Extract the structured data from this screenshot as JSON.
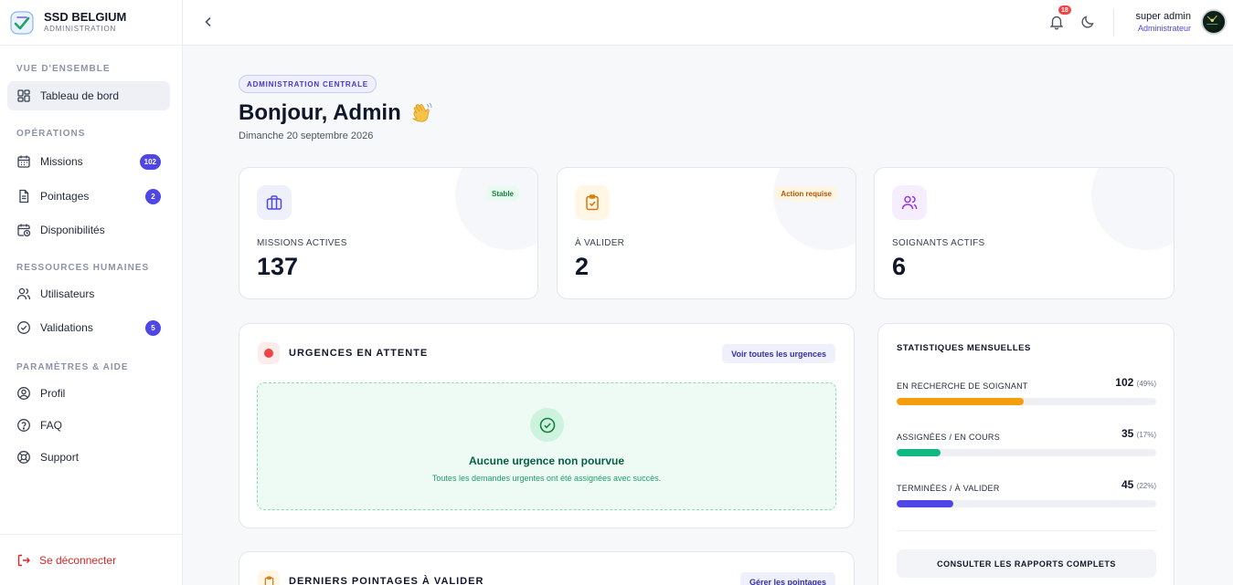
{
  "brand": {
    "name": "SSD BELGIUM",
    "subtitle": "ADMINISTRATION"
  },
  "sidebar": {
    "sections": {
      "overview": "VUE D'ENSEMBLE",
      "operations": "OPÉRATIONS",
      "hr": "RESSOURCES HUMAINES",
      "settings": "PARAMÈTRES & AIDE"
    },
    "items": [
      {
        "label": "Tableau de bord",
        "icon": "dashboard-icon",
        "active": true
      },
      {
        "label": "Missions",
        "icon": "calendar-icon",
        "badge": "102"
      },
      {
        "label": "Pointages",
        "icon": "document-icon",
        "badge": "2"
      },
      {
        "label": "Disponibilités",
        "icon": "calendar-clock-icon"
      },
      {
        "label": "Utilisateurs",
        "icon": "users-icon"
      },
      {
        "label": "Validations",
        "icon": "check-circle-icon",
        "badge": "5"
      },
      {
        "label": "Profil",
        "icon": "user-circle-icon"
      },
      {
        "label": "FAQ",
        "icon": "help-circle-icon"
      },
      {
        "label": "Support",
        "icon": "lifebuoy-icon"
      }
    ],
    "logout": "Se déconnecter"
  },
  "topbar": {
    "notification_count": "18",
    "user_name": "super admin",
    "user_role": "Administrateur"
  },
  "header": {
    "pill": "ADMINISTRATION CENTRALE",
    "greeting": "Bonjour, Admin",
    "date": "Dimanche 20 septembre 2026"
  },
  "kpis": [
    {
      "label": "MISSIONS ACTIVES",
      "value": "137",
      "tag": "Stable",
      "icon": "briefcase-icon",
      "color": "#4f46e5"
    },
    {
      "label": "À VALIDER",
      "value": "2",
      "tag": "Action requise",
      "icon": "clipboard-check-icon",
      "color": "#d97706"
    },
    {
      "label": "SOIGNANTS ACTIFS",
      "value": "6",
      "tag": "",
      "icon": "users-icon",
      "color": "#9333ea"
    }
  ],
  "urgences": {
    "title": "URGENCES EN ATTENTE",
    "button": "Voir toutes les urgences",
    "empty_title": "Aucune urgence non pourvue",
    "empty_text": "Toutes les demandes urgentes ont été assignées avec succès."
  },
  "pointages": {
    "title": "DERNIERS POINTAGES À VALIDER",
    "button": "Gérer les pointages"
  },
  "stats": {
    "title": "STATISTIQUES MENSUELLES",
    "rows": [
      {
        "label": "EN RECHERCHE DE SOIGNANT",
        "value": "102",
        "percent": "(49%)",
        "fraction": 0.49,
        "color": "#f59e0b"
      },
      {
        "label": "ASSIGNÉES / EN COURS",
        "value": "35",
        "percent": "(17%)",
        "fraction": 0.17,
        "color": "#10b981"
      },
      {
        "label": "TERMINÉES / À VALIDER",
        "value": "45",
        "percent": "(22%)",
        "fraction": 0.22,
        "color": "#4f46e5"
      }
    ],
    "button": "CONSULTER LES RAPPORTS COMPLETS"
  }
}
